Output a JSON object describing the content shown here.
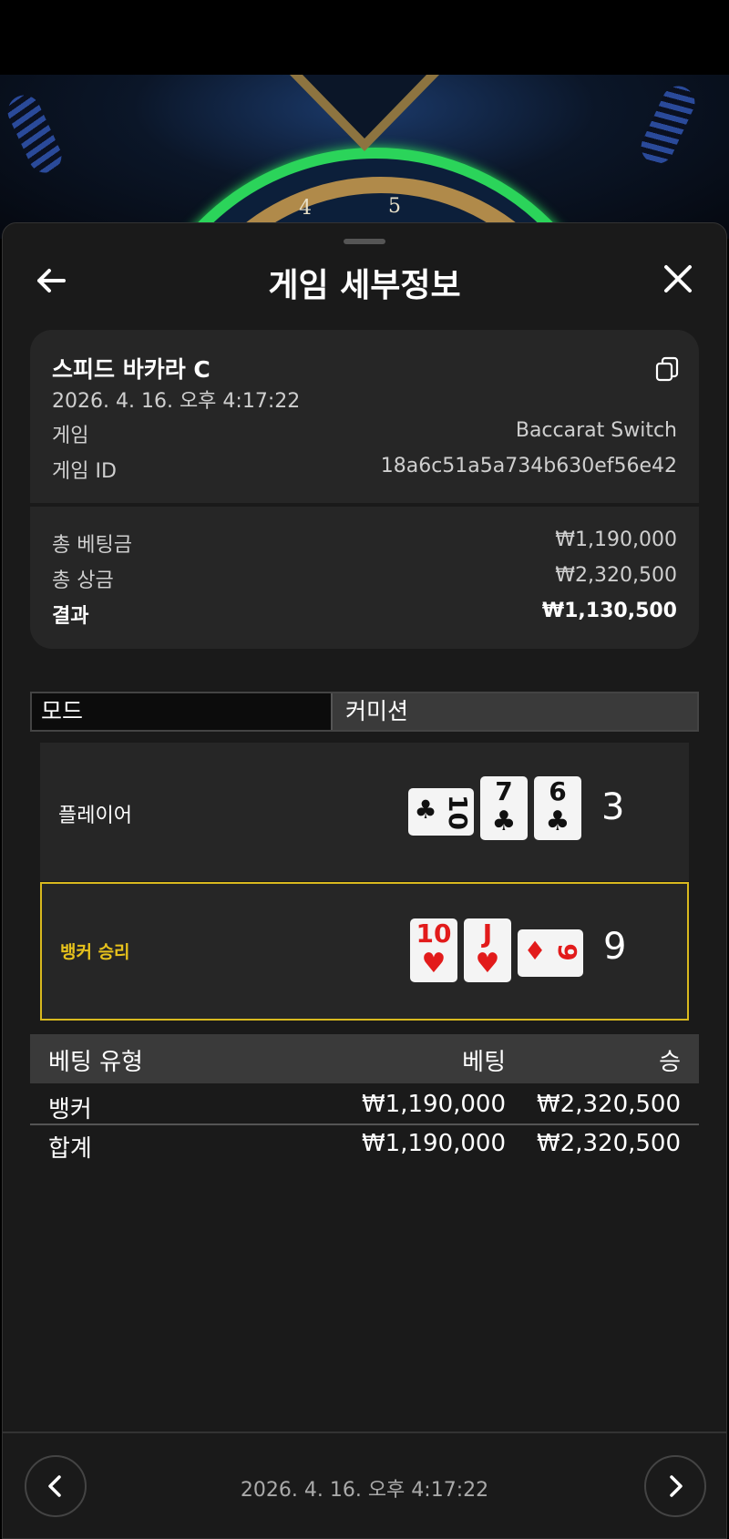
{
  "header": {
    "title": "게임 세부정보"
  },
  "game": {
    "name": "스피드 바카라 C",
    "datetime": "2026. 4. 16. 오후 4:17:22",
    "game_label": "게임",
    "game_value": "Baccarat Switch",
    "id_label": "게임 ID",
    "id_value": "18a6c51a5a734b630ef56e42"
  },
  "summary": {
    "total_bet_label": "총 베팅금",
    "total_bet_value": "₩1,190,000",
    "total_prize_label": "총 상금",
    "total_prize_value": "₩2,320,500",
    "result_label": "결과",
    "result_value": "₩1,130,500"
  },
  "mode": {
    "label": "모드",
    "value": "커미션"
  },
  "player": {
    "label": "플레이어",
    "total": "3",
    "cards": [
      {
        "rank": "10",
        "suit": "♣",
        "color": "black",
        "sideways": true
      },
      {
        "rank": "7",
        "suit": "♣",
        "color": "black",
        "sideways": false
      },
      {
        "rank": "6",
        "suit": "♣",
        "color": "black",
        "sideways": false
      }
    ]
  },
  "banker": {
    "label": "뱅커 승리",
    "total": "9",
    "highlight": "#d9b91e",
    "cards": [
      {
        "rank": "10",
        "suit": "♥",
        "color": "red",
        "sideways": false
      },
      {
        "rank": "J",
        "suit": "♥",
        "color": "red",
        "sideways": false
      },
      {
        "rank": "9",
        "suit": "♦",
        "color": "red",
        "sideways": true
      }
    ]
  },
  "bets_table": {
    "headers": [
      "베팅 유형",
      "베팅",
      "승"
    ],
    "rows": [
      [
        "뱅커",
        "₩1,190,000",
        "₩2,320,500"
      ],
      [
        "합계",
        "₩1,190,000",
        "₩2,320,500"
      ]
    ]
  },
  "footer": {
    "datetime": "2026. 4. 16. 오후 4:17:22"
  },
  "icons": {
    "back": "arrow-left-icon",
    "close": "close-icon",
    "copy": "copy-icon",
    "prev": "chevron-left-icon",
    "next": "chevron-right-icon"
  }
}
